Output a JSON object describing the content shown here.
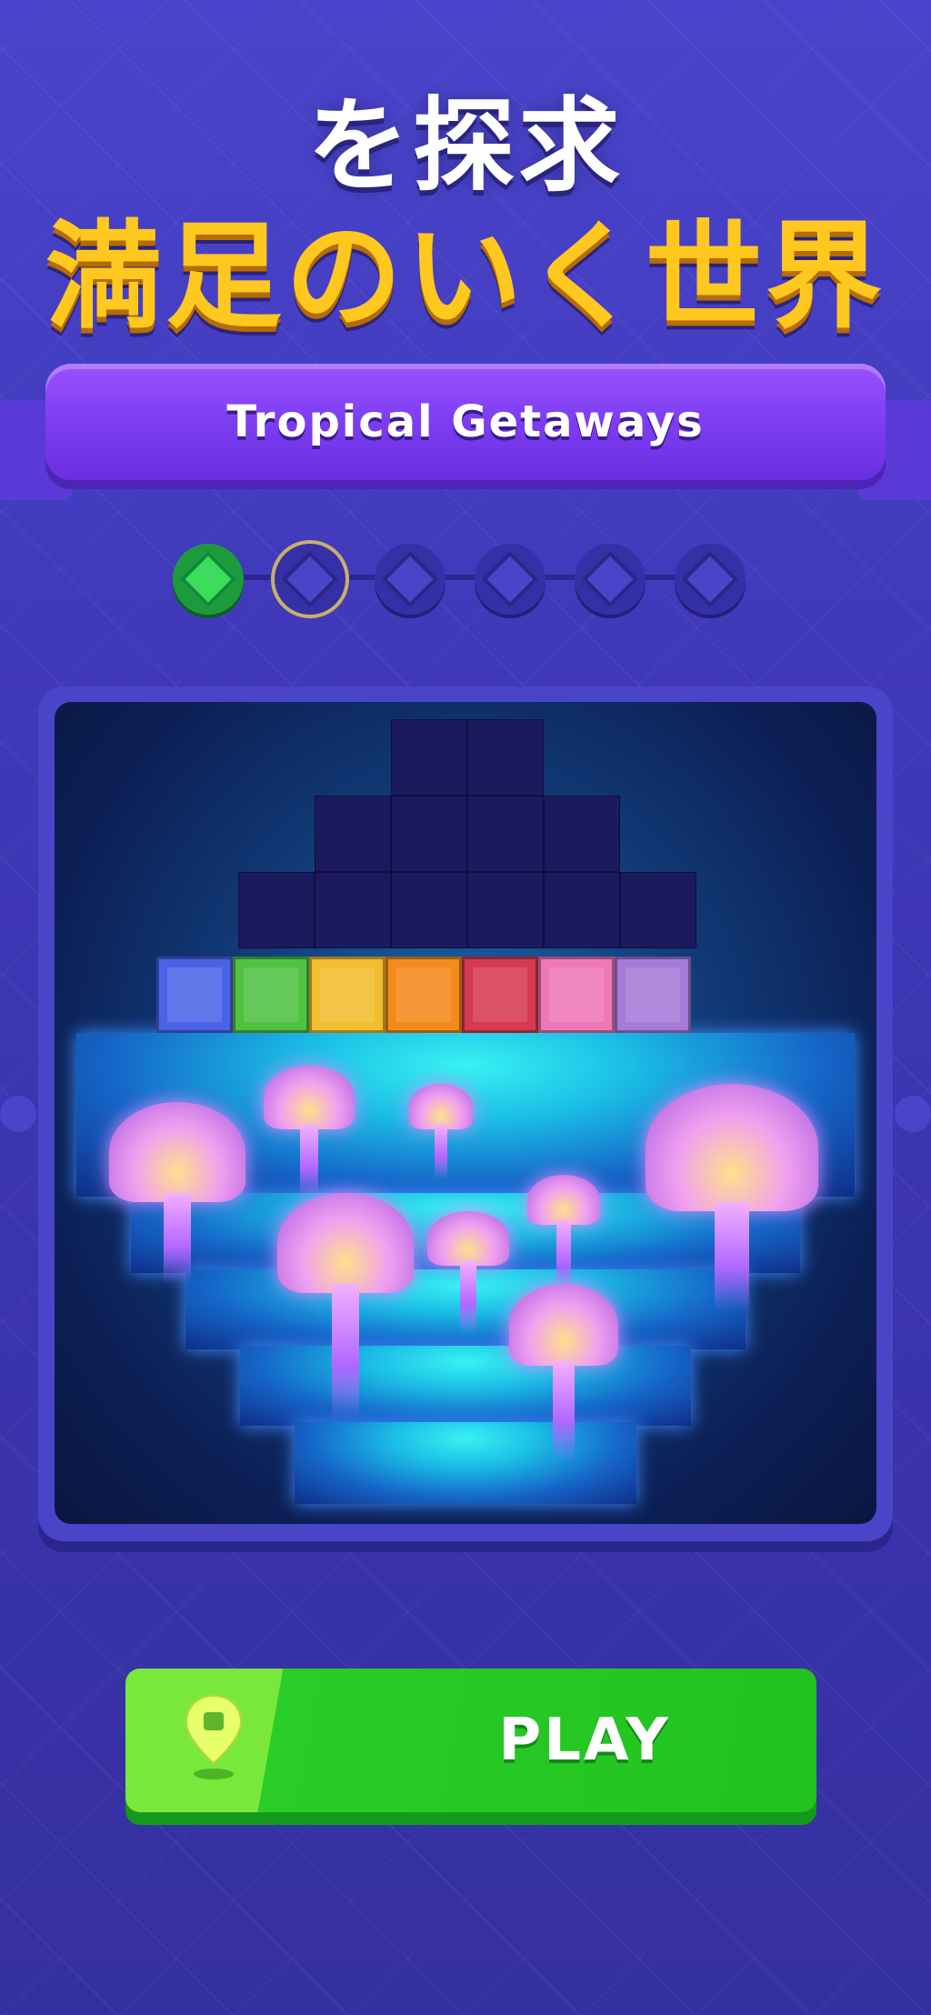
{
  "headline": {
    "line1": "を探求",
    "line2": "満足のいく世界"
  },
  "banner": {
    "title": "Tropical Getaways"
  },
  "progress": {
    "total": 6,
    "completed": 1,
    "current_index": 1
  },
  "puzzle": {
    "tile_colors": [
      "#4a63e6",
      "#4fc242",
      "#f2bd2e",
      "#f58a1c",
      "#d63a52",
      "#ef78b8",
      "#a57ad8"
    ]
  },
  "play_button": {
    "label": "PLAY",
    "icon": "map-pin-icon"
  },
  "colors": {
    "background": "#3f38b8",
    "headline_accent": "#ffc81e",
    "play": "#22c21f"
  }
}
